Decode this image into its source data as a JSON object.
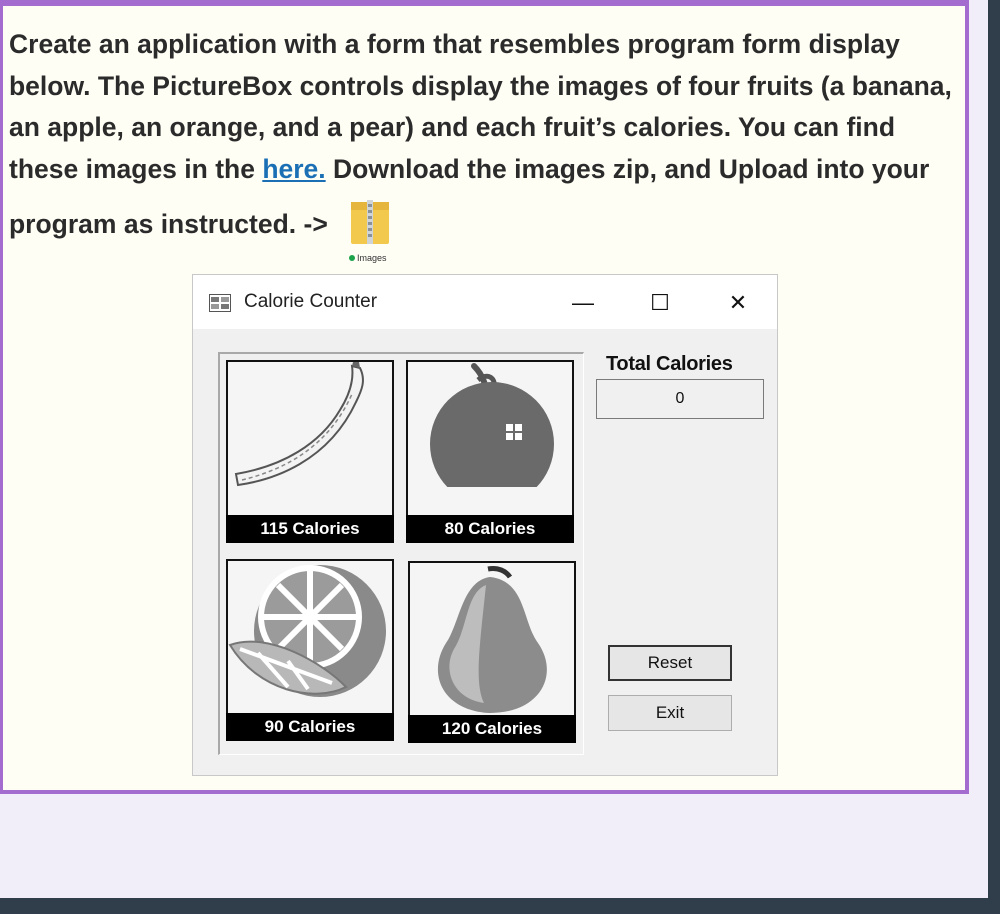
{
  "instructions": {
    "line1": "Create an application with a form that resembles program form display",
    "line2": "below. The PictureBox controls display the images of four fruits (a banana,",
    "line3": "an apple, an orange, and a pear) and each fruit’s calories. You can find",
    "line4_before": "these images in the ",
    "line4_link": "here.",
    "line4_after": " Download the images zip, and  Upload into your",
    "line5": "program as instructed.  ->"
  },
  "attachment": {
    "caption": "Images",
    "icon": "zip-folder-icon"
  },
  "window": {
    "title": "Calorie Counter",
    "minimize": "—",
    "maximize": "☐",
    "close": "✕"
  },
  "fruits": [
    {
      "name": "banana",
      "calories": "115 Calories"
    },
    {
      "name": "apple",
      "calories": "80 Calories"
    },
    {
      "name": "orange",
      "calories": "90 Calories"
    },
    {
      "name": "pear",
      "calories": "120 Calories"
    }
  ],
  "total": {
    "label": "Total Calories",
    "value": "0"
  },
  "buttons": {
    "reset": "Reset",
    "exit": "Exit"
  },
  "colors": {
    "panel_border": "#a56ccf",
    "link": "#1a6fb5",
    "panel_bg": "#fffef5",
    "page_bg": "#f1eefa"
  }
}
